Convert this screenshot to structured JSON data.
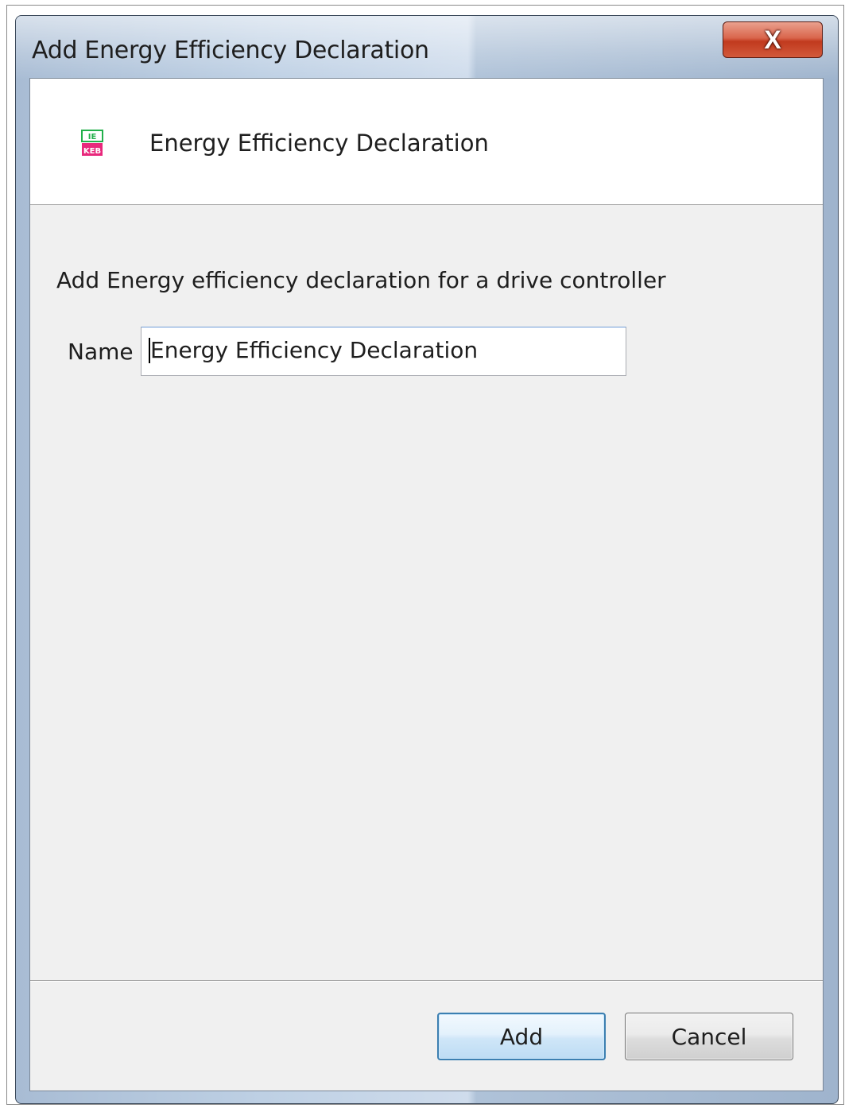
{
  "window": {
    "title": "Add Energy Efficiency Declaration",
    "close_glyph": "X"
  },
  "header": {
    "icon": "iekeb-icon",
    "title": "Energy Efficiency Declaration"
  },
  "form": {
    "description": "Add Energy efficiency declaration for a drive controller",
    "name_label": "Name",
    "name_value": "Energy Efficiency Declaration"
  },
  "footer": {
    "add_label": "Add",
    "cancel_label": "Cancel"
  },
  "colors": {
    "close_button": "#c13a1e",
    "default_button_border": "#3c7fb1",
    "content_background": "#f0f0f0"
  }
}
